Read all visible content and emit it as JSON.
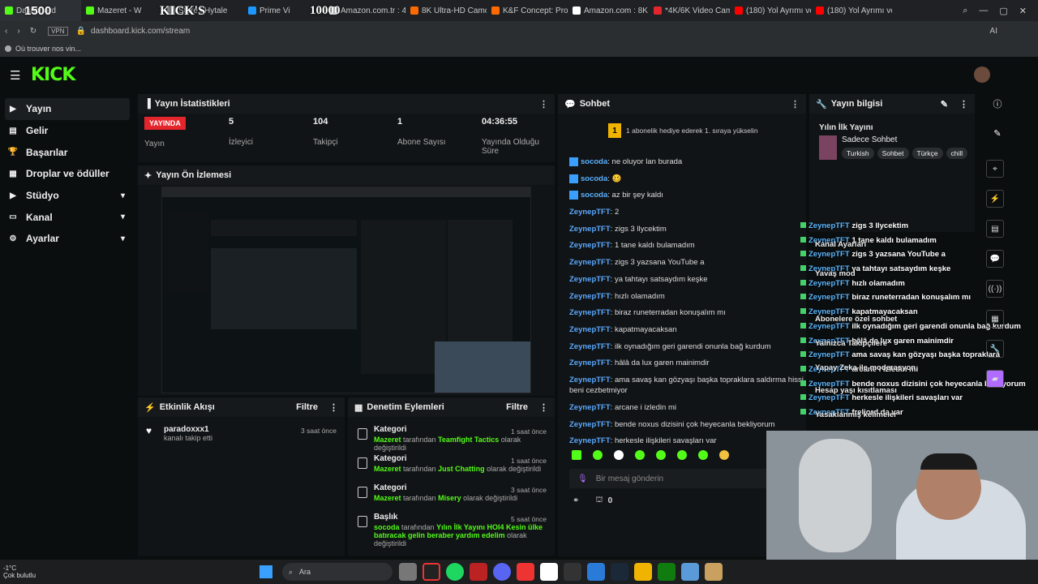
{
  "browser": {
    "tabs": [
      {
        "label": "Dashboard",
        "color": "#53fc18",
        "active": true
      },
      {
        "label": "Mazeret - W",
        "color": "#53fc18"
      },
      {
        "label": "Store | Hytale",
        "color": "#888888"
      },
      {
        "label": "Prime Vi",
        "color": "#1a98ff"
      },
      {
        "label": "Amazon.com.tr : 4",
        "color": "#ffffff"
      },
      {
        "label": "8K Ultra-HD Camc",
        "color": "#ff6a00"
      },
      {
        "label": "K&F Concept: Prof",
        "color": "#ff6a00"
      },
      {
        "label": "Amazon.com : 8K",
        "color": "#ffffff"
      },
      {
        "label": "*4K/6K Video Cam",
        "color": "#e5252c"
      },
      {
        "label": "(180) Yol Ayrımı ve",
        "color": "#ff0000"
      },
      {
        "label": "(180) Yol Ayrımı ve",
        "color": "#ff0000"
      }
    ],
    "overlay_numbers": {
      "left": "1500",
      "middle": "KICK'S",
      "right": "10000"
    },
    "vpn_label": "VPN",
    "url": "dashboard.kick.com/stream",
    "ai_label": "AI",
    "bookmark": "Où trouver nos vin..."
  },
  "header": {
    "logo": "KICK"
  },
  "sidebar": {
    "items": [
      {
        "label": "Yayın",
        "icon": "stream-icon",
        "chev": false
      },
      {
        "label": "Gelir",
        "icon": "money-icon",
        "chev": false
      },
      {
        "label": "Başarılar",
        "icon": "trophy-icon",
        "chev": false
      },
      {
        "label": "Droplar ve ödüller",
        "icon": "gift-icon",
        "chev": false
      },
      {
        "label": "Stüdyo",
        "icon": "studio-icon",
        "chev": true
      },
      {
        "label": "Kanal",
        "icon": "channel-icon",
        "chev": true
      },
      {
        "label": "Ayarlar",
        "icon": "gear-icon",
        "chev": true
      }
    ]
  },
  "stats": {
    "title": "Yayın İstatistikleri",
    "live": "YAYINDA",
    "live_label": "Yayın",
    "items": [
      {
        "value": "5",
        "label": "İzleyici"
      },
      {
        "value": "104",
        "label": "Takipçi"
      },
      {
        "value": "1",
        "label": "Abone Sayısı"
      },
      {
        "value": "04:36:55",
        "label": "Yayında Olduğu Süre"
      }
    ]
  },
  "preview": {
    "title": "Yayın Ön İzlemesi"
  },
  "activity": {
    "title": "Etkinlik Akışı",
    "filter": "Filtre",
    "items": [
      {
        "user": "paradoxxx1",
        "text": "kanalı takip etti",
        "time": "3 saat önce"
      }
    ]
  },
  "moderation": {
    "title": "Denetim Eylemleri",
    "filter": "Filtre",
    "items": [
      {
        "type": "Kategori",
        "time": "1 saat önce",
        "by": "Mazeret",
        "mid": "tarafından",
        "value": "Teamfight Tactics",
        "end": "olarak değiştirildi"
      },
      {
        "type": "Kategori",
        "time": "1 saat önce",
        "by": "Mazeret",
        "mid": "tarafından",
        "value": "Just Chatting",
        "end": "olarak değiştirildi"
      },
      {
        "type": "Kategori",
        "time": "3 saat önce",
        "by": "Mazeret",
        "mid": "tarafından",
        "value": "Misery",
        "end": "olarak değiştirildi"
      },
      {
        "type": "Başlık",
        "time": "5 saat önce",
        "by": "socoda",
        "mid": "tarafından",
        "value": "Yılın İlk Yayını HOI4 Kesin ülke batıracak gelin beraber yardım edelim",
        "end": "olarak değiştirildi"
      }
    ]
  },
  "chat": {
    "title": "Sohbet",
    "gift_text": "1 abonelik hediye ederek 1. sıraya yükselin",
    "gift_rank": "1",
    "messages": [
      {
        "user": "socoda",
        "text": "ne oluyor lan burada"
      },
      {
        "user": "socoda",
        "text": "🥴"
      },
      {
        "user": "socoda",
        "text": "az bir şey kaldı"
      },
      {
        "user": "ZeynepTFT",
        "text": "2"
      },
      {
        "user": "ZeynepTFT",
        "text": "zigs 3 llycektim"
      },
      {
        "user": "ZeynepTFT",
        "text": "1 tane kaldı bulamadım"
      },
      {
        "user": "ZeynepTFT",
        "text": "zigs 3 yazsana YouTube a"
      },
      {
        "user": "ZeynepTFT",
        "text": "ya tahtayı satsaydım keşke"
      },
      {
        "user": "ZeynepTFT",
        "text": "hızlı olamadım"
      },
      {
        "user": "ZeynepTFT",
        "text": "biraz runeterradan konuşalım mı"
      },
      {
        "user": "ZeynepTFT",
        "text": "kapatmayacaksan"
      },
      {
        "user": "ZeynepTFT",
        "text": "ilk oynadığım geri garendi onunla bağ kurdum"
      },
      {
        "user": "ZeynepTFT",
        "text": "hâlâ da lux garen mainimdir"
      },
      {
        "user": "ZeynepTFT",
        "text": "ama savaş kan gözyaşı başka topraklara saldırma hissi beni cezbetmiyor"
      },
      {
        "user": "ZeynepTFT",
        "text": "arcane i izledin mi"
      },
      {
        "user": "ZeynepTFT",
        "text": "bende noxus dizisini çok heyecanla bekliyorum"
      },
      {
        "user": "ZeynepTFT",
        "text": "herkesle ilişkileri savaşları var"
      },
      {
        "user": "ZeynepTFT",
        "text": "freljord da var"
      }
    ],
    "input_placeholder": "Bir mesaj gönderin",
    "points": "0"
  },
  "info": {
    "title": "Yayın bilgisi",
    "stream_title": "Yılın İlk Yayını",
    "category": "Sadece Sohbet",
    "tags": [
      "Turkish",
      "Sohbet",
      "Türkçe",
      "chill"
    ]
  },
  "overlay_chat": [
    {
      "user": "ZeynepTFT",
      "text": "zigs 3 llycektim"
    },
    {
      "user": "ZeynepTFT",
      "text": "1 tane kaldı bulamadım"
    },
    {
      "user": "ZeynepTFT",
      "text": "zigs 3 yazsana YouTube a"
    },
    {
      "user": "ZeynepTFT",
      "text": "ya tahtayı satsaydım keşke"
    },
    {
      "user": "ZeynepTFT",
      "text": "hızlı olamadım"
    },
    {
      "user": "ZeynepTFT",
      "text": "biraz runeterradan konuşalım mı"
    },
    {
      "user": "ZeynepTFT",
      "text": "kapatmayacaksan"
    },
    {
      "user": "ZeynepTFT",
      "text": "ilk oynadığım geri garendi onunla bağ kurdum"
    },
    {
      "user": "ZeynepTFT",
      "text": "hâlâ da lux garen mainimdir"
    },
    {
      "user": "ZeynepTFT",
      "text": "ama savaş kan gözyaşı başka topraklara"
    },
    {
      "user": "ZeynepTFT",
      "text": "arcane i izledin mi"
    },
    {
      "user": "ZeynepTFT",
      "text": "bende noxus dizisini çok heyecanla bekliyorum"
    },
    {
      "user": "ZeynepTFT",
      "text": "herkesle ilişkileri savaşları var"
    },
    {
      "user": "ZeynepTFT",
      "text": "freljord da var"
    }
  ],
  "overlay_settings": [
    "Kanal Ayarları",
    "Yavaş mod",
    "Abonelere özel sohbet",
    "Yalnızca Takipçilere",
    "Yapay Zeka ile moderasyon",
    "Hesap yaşı kısıtlaması",
    "Yasaklanmış kelimeler"
  ],
  "taskbar": {
    "weather_temp": "-1°C",
    "weather_text": "Çok bulutlu",
    "search": "Ara"
  }
}
